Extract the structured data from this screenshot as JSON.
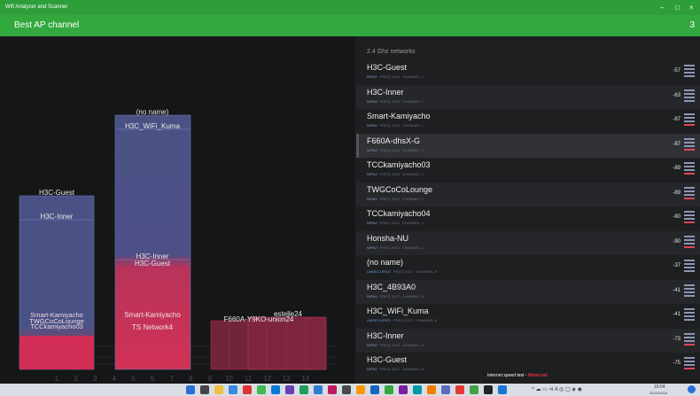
{
  "window": {
    "title": "Wifi Analyzer and Scanner",
    "controls": [
      "–",
      "□",
      "×"
    ]
  },
  "header": {
    "title": "Best AP channel",
    "count": "3"
  },
  "chart": {
    "channel_ticks": [
      "1",
      "2",
      "3",
      "4",
      "5",
      "6",
      "7",
      "8",
      "9",
      "10",
      "11",
      "12",
      "13",
      "14"
    ],
    "groups": [
      {
        "label": "H3C-Guest",
        "label2": "H3C-Inner",
        "stacked": "Smart-Kamiyacho",
        "stacked2": "TWGCoCoLounge",
        "stacked3": "TCCkamiyacho03"
      },
      {
        "label": "(no name)",
        "label2": "H3C_WiFi_Kuma",
        "mid": "H3C-Inner",
        "mid2": "H3C-Guest",
        "bottom": "Smart-Kamiyacho",
        "bottom2": "TS Network4"
      },
      {
        "label": "F660A-Y9KO-union24",
        "label2": "estelle24"
      }
    ]
  },
  "list": {
    "section": "2.4 Ghz networks",
    "networks": [
      {
        "name": "H3C-Guest",
        "sec": "WPA2",
        "freq": "FREQ 2412",
        "channel": "CHANNEL 1",
        "rssi": "-57"
      },
      {
        "name": "H3C-Inner",
        "sec": "WPA2",
        "freq": "FREQ 2412",
        "channel": "CHANNEL 1",
        "rssi": "-63"
      },
      {
        "name": "Smart-Kamiyacho",
        "sec": "WPA2",
        "freq": "FREQ 2412",
        "channel": "CHANNEL 1",
        "rssi": "-87"
      },
      {
        "name": "F660A-dhsX-G",
        "sec": "WPA2",
        "freq": "FREQ 2412",
        "channel": "CHANNEL 1",
        "rssi": "-87"
      },
      {
        "name": "TCCkamiyacho03",
        "sec": "WPA2",
        "freq": "FREQ 2412",
        "channel": "CHANNEL 1",
        "rssi": "-89"
      },
      {
        "name": "TWGCoCoLounge",
        "sec": "WPA2",
        "freq": "FREQ 2412",
        "channel": "CHANNEL 1",
        "rssi": "-89"
      },
      {
        "name": "TCCkamiyacho04",
        "sec": "WPA2",
        "freq": "FREQ 2412",
        "channel": "CHANNEL 1",
        "rssi": "-90"
      },
      {
        "name": "Honsha-NU",
        "sec": "WPA2",
        "freq": "FREQ 2412",
        "channel": "CHANNEL 1",
        "rssi": "-90"
      },
      {
        "name": "(no name)",
        "sec": "UNSECURED",
        "freq": "FREQ 2437",
        "channel": "CHANNEL 6",
        "rssi": "-37"
      },
      {
        "name": "H3C_4B93A0",
        "sec": "WPA2",
        "freq": "FREQ 2437",
        "channel": "CHANNEL 6",
        "rssi": "-41"
      },
      {
        "name": "H3C_WiFi_Kuma",
        "sec": "UNSECURED",
        "freq": "FREQ 2437",
        "channel": "CHANNEL 6",
        "rssi": "-41"
      },
      {
        "name": "H3C-Inner",
        "sec": "WPA2",
        "freq": "FREQ 2437",
        "channel": "CHANNEL 6",
        "rssi": "-73"
      },
      {
        "name": "H3C-Guest",
        "sec": "WPA2",
        "freq": "FREQ 2437",
        "channel": "CHANNEL 6",
        "rssi": "-75"
      }
    ]
  },
  "speedtest": {
    "text": "Internet speed test -",
    "link": "Meter.net"
  },
  "taskbar": {
    "time": "15:04",
    "date": "2023/10/19"
  }
}
